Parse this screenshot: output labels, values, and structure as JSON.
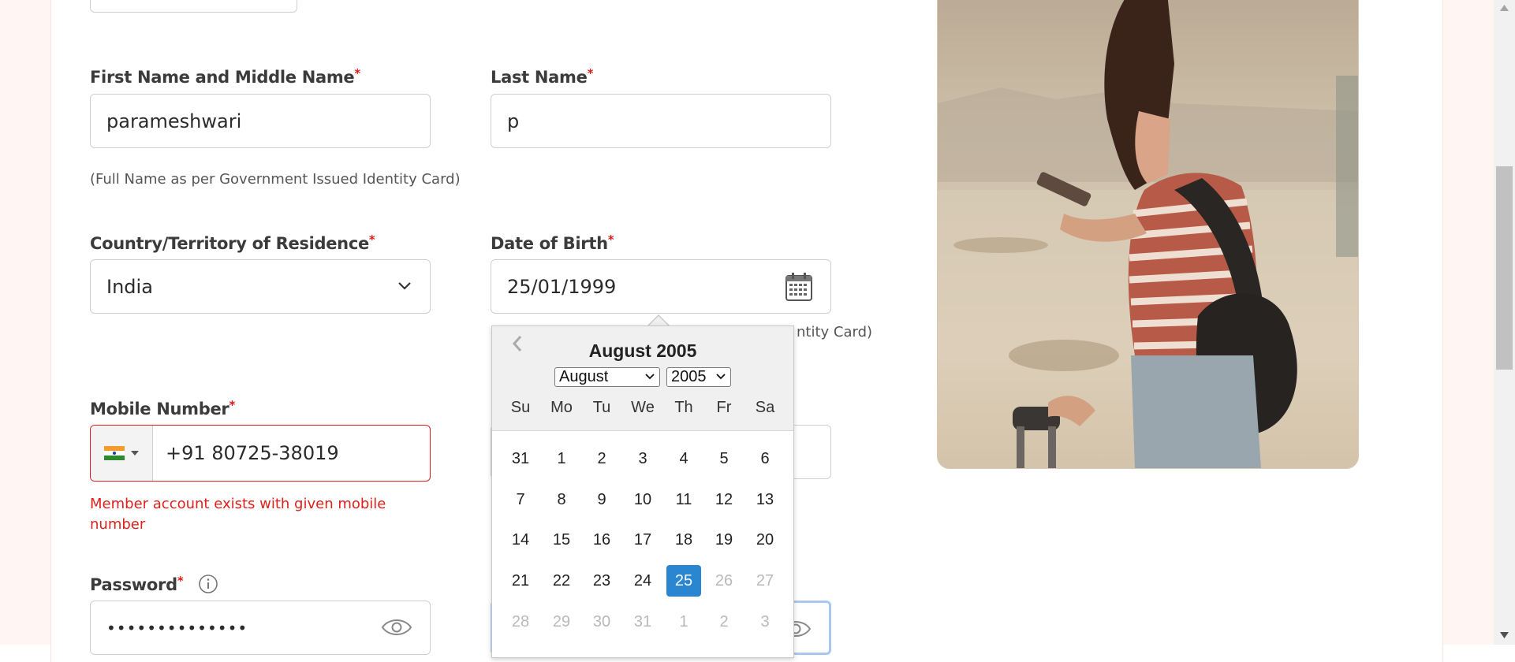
{
  "form": {
    "first_name_label": "First Name and Middle Name",
    "first_name_value": "parameshwari",
    "last_name_label": "Last Name",
    "last_name_value": "p",
    "name_helper": "(Full Name as per Government Issued Identity Card)",
    "country_label": "Country/Territory of Residence",
    "country_value": "India",
    "dob_label": "Date of Birth",
    "dob_value": "25/01/1999",
    "dob_helper_visible": "ntity Card)",
    "mobile_label": "Mobile Number",
    "mobile_value": "+91 80725-38019",
    "mobile_error": "Member account exists with given mobile number",
    "password_label": "Password",
    "password_value": "••••••••••••••",
    "required_mark": "*"
  },
  "calendar": {
    "title": "August 2005",
    "month_select": "August",
    "year_select": "2005",
    "weekdays": [
      "Su",
      "Mo",
      "Tu",
      "We",
      "Th",
      "Fr",
      "Sa"
    ],
    "weeks": [
      [
        "31",
        "1",
        "2",
        "3",
        "4",
        "5",
        "6"
      ],
      [
        "7",
        "8",
        "9",
        "10",
        "11",
        "12",
        "13"
      ],
      [
        "14",
        "15",
        "16",
        "17",
        "18",
        "19",
        "20"
      ],
      [
        "21",
        "22",
        "23",
        "24",
        "25",
        "26",
        "27"
      ],
      [
        "28",
        "29",
        "30",
        "31",
        "1",
        "2",
        "3"
      ]
    ],
    "selected_day": "25",
    "prev_icon": "chevron-left-icon"
  },
  "colors": {
    "error": "#e0201b",
    "selected_day": "#2a86d1",
    "page_side": "#fff5f2"
  }
}
